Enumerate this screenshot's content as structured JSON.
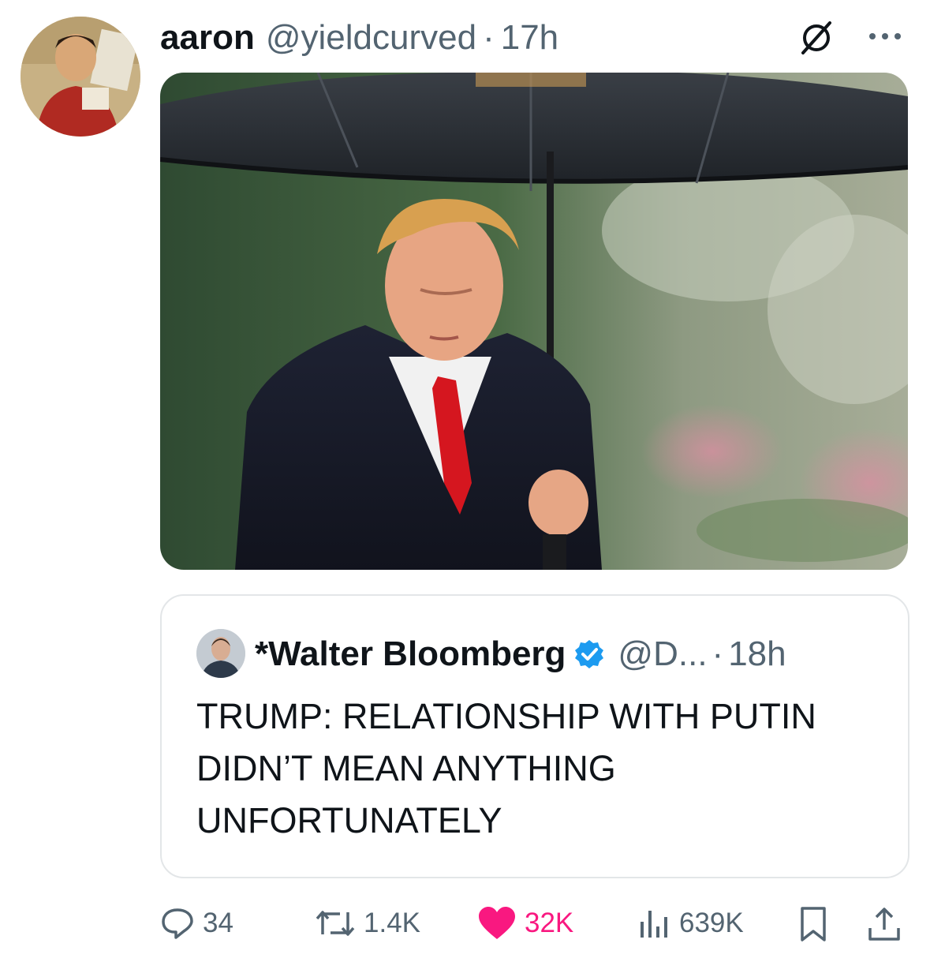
{
  "tweet": {
    "author_name": "aaron",
    "author_handle": "@yieldcurved",
    "separator": "·",
    "time": "17h"
  },
  "quote": {
    "author_name": "*Walter Bloomberg",
    "author_handle": "@D...",
    "separator": "·",
    "time": "18h",
    "text": "TRUMP: RELATIONSHIP WITH PUTIN\nDIDN’T MEAN ANYTHING\nUNFORTUNATELY"
  },
  "actions": {
    "replies": "34",
    "reposts": "1.4K",
    "likes": "32K",
    "views": "639K"
  },
  "colors": {
    "secondary_text": "#536471",
    "like_active": "#f91880",
    "verified_blue": "#1d9bf0",
    "border": "#e3e6e8"
  },
  "icons": [
    "grok-icon",
    "more-icon",
    "verified-badge-icon",
    "reply-icon",
    "repost-icon",
    "like-icon",
    "views-icon",
    "bookmark-icon",
    "share-icon"
  ]
}
